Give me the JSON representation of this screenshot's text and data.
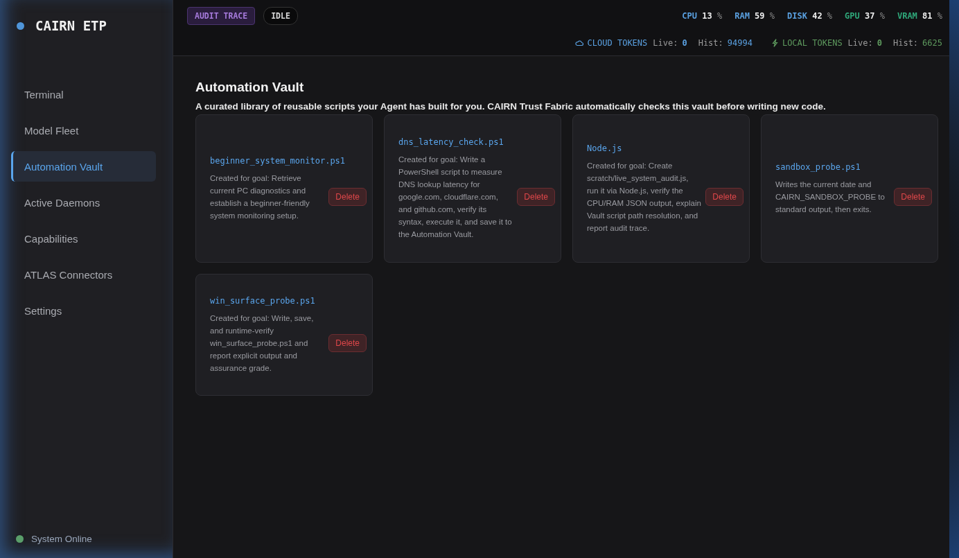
{
  "brand": {
    "name": "CAIRN ETP"
  },
  "sidebar": {
    "items": [
      {
        "label": "Terminal",
        "selected": false
      },
      {
        "label": "Model Fleet",
        "selected": false
      },
      {
        "label": "Automation Vault",
        "selected": true
      },
      {
        "label": "Active Daemons",
        "selected": false
      },
      {
        "label": "Capabilities",
        "selected": false
      },
      {
        "label": "ATLAS Connectors",
        "selected": false
      },
      {
        "label": "Settings",
        "selected": false
      }
    ],
    "status": {
      "label": "System Online",
      "color": "#5a9e6a"
    }
  },
  "header": {
    "badges": [
      {
        "label": "AUDIT TRACE",
        "kind": "accent"
      },
      {
        "label": "IDLE",
        "kind": "pill"
      }
    ],
    "metrics": [
      {
        "label": "CPU",
        "value": "13",
        "unit": "%",
        "color": "#5aa0e0"
      },
      {
        "label": "RAM",
        "value": "59",
        "unit": "%",
        "color": "#5aa0e0"
      },
      {
        "label": "DISK",
        "value": "42",
        "unit": "%",
        "color": "#5aa0e0"
      },
      {
        "label": "GPU",
        "value": "37",
        "unit": "%",
        "color": "#2fa87a"
      },
      {
        "label": "VRAM",
        "value": "81",
        "unit": "%",
        "color": "#2fa87a"
      }
    ],
    "tokens": [
      {
        "kind": "cloud",
        "label": "CLOUD TOKENS",
        "live_label": "Live:",
        "live": "0",
        "hist_label": "Hist:",
        "hist": "94994",
        "color": "#5aa0e0"
      },
      {
        "kind": "local",
        "label": "LOCAL TOKENS",
        "live_label": "Live:",
        "live": "0",
        "hist_label": "Hist:",
        "hist": "6625",
        "color": "#5e9a5e"
      }
    ]
  },
  "page": {
    "title": "Automation Vault",
    "subtitle": "A curated library of reusable scripts your Agent has built for you. CAIRN Trust Fabric automatically checks this vault before writing new code.",
    "scripts": [
      {
        "name": "beginner_system_monitor.ps1",
        "description": "Created for goal: Retrieve current PC diagnostics and establish a beginner-friendly system monitoring setup.",
        "action": "Delete"
      },
      {
        "name": "dns_latency_check.ps1",
        "description": "Created for goal: Write a PowerShell script to measure DNS lookup latency for google.com, cloudflare.com, and github.com, verify its syntax, execute it, and save it to the Automation Vault.",
        "action": "Delete"
      },
      {
        "name": "Node.js",
        "description": "Created for goal: Create scratch/live_system_audit.js, run it via Node.js, verify the CPU/RAM JSON output, explain Vault script path resolution, and report audit trace.",
        "action": "Delete"
      },
      {
        "name": "sandbox_probe.ps1",
        "description": "Writes the current date and CAIRN_SANDBOX_PROBE to standard output, then exits.",
        "action": "Delete"
      },
      {
        "name": "win_surface_probe.ps1",
        "description": "Created for goal: Write, save, and runtime-verify win_surface_probe.ps1 and report explicit output and assurance grade.",
        "action": "Delete"
      }
    ]
  }
}
